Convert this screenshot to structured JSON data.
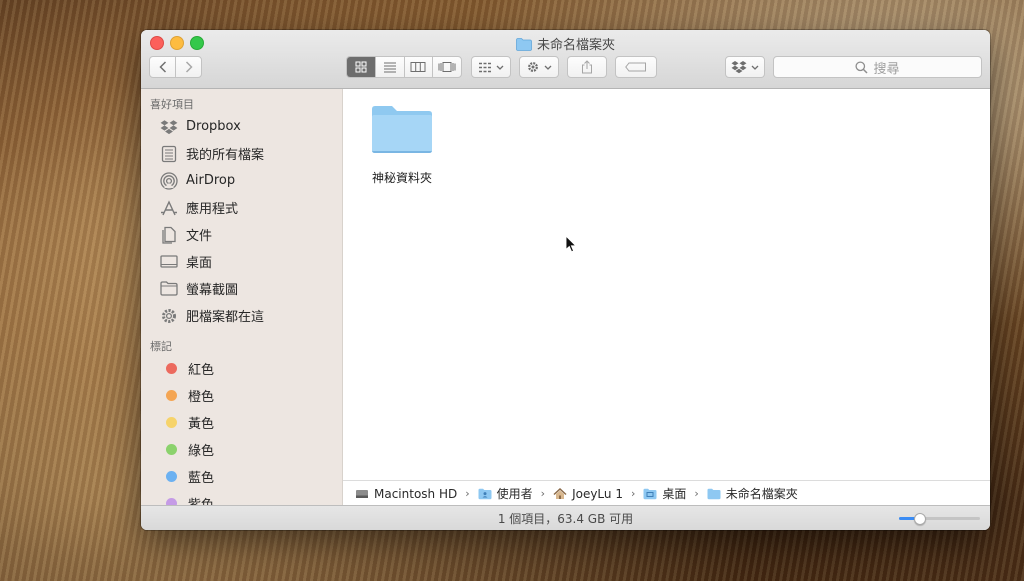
{
  "window": {
    "title": "未命名檔案夾",
    "search_placeholder": "搜尋"
  },
  "toolbar": {
    "back_icon": "chevron-left-icon",
    "forward_icon": "chevron-right-icon",
    "view_modes": [
      "icon-view",
      "list-view",
      "column-view",
      "cover-flow-view"
    ],
    "active_view": "icon-view"
  },
  "sidebar": {
    "favorites_header": "喜好項目",
    "favorites": [
      {
        "label": "Dropbox",
        "icon": "dropbox-icon"
      },
      {
        "label": "我的所有檔案",
        "icon": "all-files-icon"
      },
      {
        "label": "AirDrop",
        "icon": "airdrop-icon"
      },
      {
        "label": "應用程式",
        "icon": "applications-icon"
      },
      {
        "label": "文件",
        "icon": "documents-icon"
      },
      {
        "label": "桌面",
        "icon": "desktop-icon"
      },
      {
        "label": "螢幕截圖",
        "icon": "folder-icon"
      },
      {
        "label": "肥檔案都在這",
        "icon": "gear-folder-icon"
      }
    ],
    "tags_header": "標記",
    "tags": [
      {
        "label": "紅色",
        "color": "#ec6a5e"
      },
      {
        "label": "橙色",
        "color": "#f4a553"
      },
      {
        "label": "黃色",
        "color": "#f6d36a"
      },
      {
        "label": "綠色",
        "color": "#8bd26c"
      },
      {
        "label": "藍色",
        "color": "#6cb1f1"
      },
      {
        "label": "紫色",
        "color": "#c59be6"
      }
    ]
  },
  "content": {
    "items": [
      {
        "name": "神秘資料夾",
        "type": "folder"
      }
    ]
  },
  "pathbar": {
    "segments": [
      "Macintosh HD",
      "使用者",
      "JoeyLu 1",
      "桌面",
      "未命名檔案夾"
    ]
  },
  "statusbar": {
    "text": "1 個項目，63.4 GB 可用",
    "zoom_level": 0.25
  }
}
